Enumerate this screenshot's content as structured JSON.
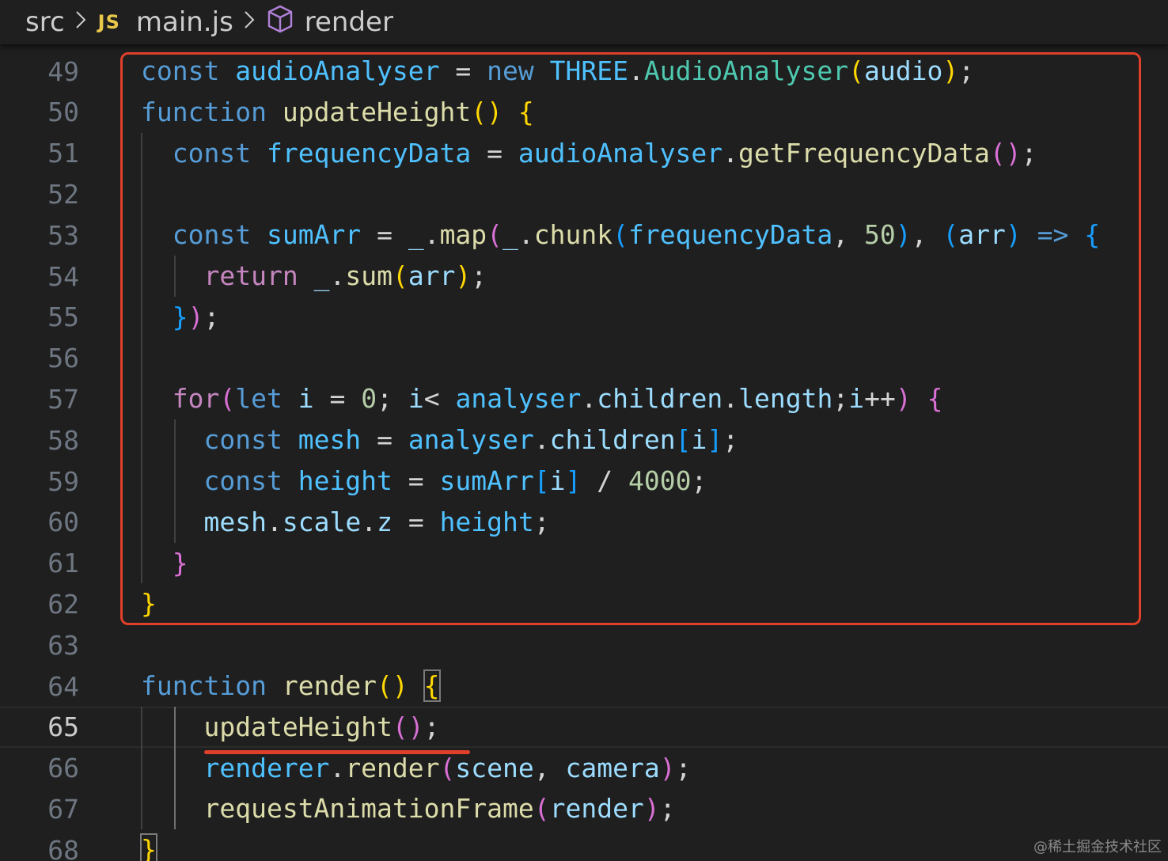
{
  "breadcrumb": {
    "folder": "src",
    "file_badge": "JS",
    "file": "main.js",
    "symbol": "render"
  },
  "icons": {
    "separator": "chevron-right-icon",
    "file_type": "javascript-file-icon",
    "symbol": "cube-method-icon"
  },
  "editor": {
    "current_line": "65",
    "lines": [
      {
        "n": "49",
        "code": "const audioAnalyser = new THREE.AudioAnalyser(audio);"
      },
      {
        "n": "50",
        "code": "function updateHeight() {"
      },
      {
        "n": "51",
        "code": "  const frequencyData = audioAnalyser.getFrequencyData();"
      },
      {
        "n": "52",
        "code": ""
      },
      {
        "n": "53",
        "code": "  const sumArr = _.map(_.chunk(frequencyData, 50), (arr) => {"
      },
      {
        "n": "54",
        "code": "    return _.sum(arr);"
      },
      {
        "n": "55",
        "code": "  });"
      },
      {
        "n": "56",
        "code": ""
      },
      {
        "n": "57",
        "code": "  for(let i = 0; i< analyser.children.length;i++) {"
      },
      {
        "n": "58",
        "code": "    const mesh = analyser.children[i];"
      },
      {
        "n": "59",
        "code": "    const height = sumArr[i] / 4000;"
      },
      {
        "n": "60",
        "code": "    mesh.scale.z = height;"
      },
      {
        "n": "61",
        "code": "  }"
      },
      {
        "n": "62",
        "code": "}"
      },
      {
        "n": "63",
        "code": ""
      },
      {
        "n": "64",
        "code": "function render() {"
      },
      {
        "n": "65",
        "code": "    updateHeight();"
      },
      {
        "n": "66",
        "code": "    renderer.render(scene, camera);"
      },
      {
        "n": "67",
        "code": "    requestAnimationFrame(render);"
      },
      {
        "n": "68",
        "code": "}"
      }
    ]
  },
  "annotations": {
    "box_color": "#e0402a",
    "underline_color": "#e0402a"
  },
  "watermark": "@稀土掘金技术社区",
  "colors": {
    "background": "#1f1f1f",
    "keyword": "#569cd6",
    "control": "#c586c0",
    "variable": "#4fc1ff",
    "property": "#9cdcfe",
    "function": "#dcdcaa",
    "class": "#4ec9b0",
    "number": "#b5cea8",
    "bracket1": "#ffd700",
    "bracket2": "#da70d6",
    "bracket3": "#179fff"
  }
}
